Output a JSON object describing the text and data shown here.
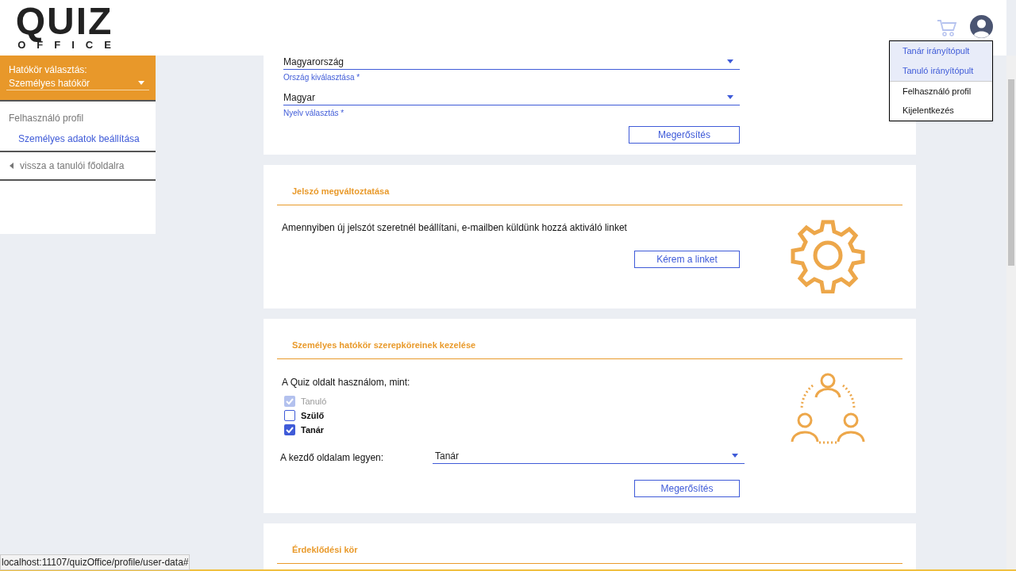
{
  "logo": {
    "word": "QUIZ",
    "subword": "OFFICE"
  },
  "header": {
    "menu": [
      {
        "label": "Tanár irányítópult",
        "kind": "dashboard"
      },
      {
        "label": "Tanuló irányítópult",
        "kind": "dashboard"
      },
      {
        "label": "Felhasználó profil",
        "kind": "account"
      },
      {
        "label": "Kijelentkezés",
        "kind": "account"
      }
    ]
  },
  "sidebar": {
    "scope_label": "Hatókör választás:",
    "scope_value": "Személyes hatókör",
    "section": "Felhasználó profil",
    "items": [
      {
        "label": "Személyes adatok beállítása",
        "kind": "link"
      },
      {
        "label": "vissza a tanulói főoldalra",
        "kind": "back"
      }
    ]
  },
  "personal_data": {
    "fields": [
      {
        "value": "Magyarország",
        "label": "Ország kiválasztása *"
      },
      {
        "value": "Magyar",
        "label": "Nyelv választás *"
      }
    ],
    "button": "Megerősítés"
  },
  "password": {
    "title": "Jelszó megváltoztatása",
    "text": "Amennyiben új jelszót szeretnél beállítani, e-mailben küldünk hozzá aktiváló linket",
    "button": "Kérem a linket"
  },
  "roles": {
    "title": "Személyes hatókör szerepköreinek kezelése",
    "intro": "A Quiz oldalt használom, mint:",
    "options": [
      {
        "label": "Tanuló",
        "checked": true,
        "disabled": true
      },
      {
        "label": "Szülő",
        "checked": false,
        "disabled": false
      },
      {
        "label": "Tanár",
        "checked": true,
        "disabled": false
      }
    ],
    "start_label": "A kezdő oldalam legyen:",
    "start_value": "Tanár",
    "button": "Megerősítés"
  },
  "interests": {
    "title": "Érdeklődési kör"
  },
  "status_bar": "localhost:11107/quizOffice/profile/user-data#"
}
